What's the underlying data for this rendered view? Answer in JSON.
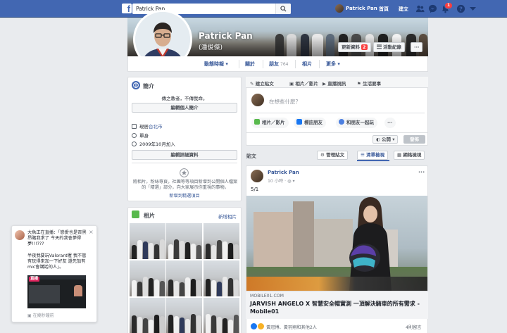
{
  "topbar": {
    "search_value": "Patrick Pan",
    "search_placeholder": "搜尋",
    "user_name": "Patrick Pan",
    "home": "首頁",
    "create": "建立",
    "notif_count": "1"
  },
  "profile": {
    "name": "Patrick Pan",
    "alt_name": "(潘俊傑)",
    "update_info": "更新資料",
    "update_count": "2",
    "activity_log": "活動紀錄",
    "more": "···"
  },
  "tabs": [
    {
      "label": "動態時報 ▾"
    },
    {
      "label": "關於"
    },
    {
      "label": "朋友",
      "count": "764"
    },
    {
      "label": "相片"
    },
    {
      "label": "更多 ▾"
    }
  ],
  "intro": {
    "title": "簡介",
    "bio": "傳之教者，不傳我命。",
    "edit_bio": "編輯個人簡介",
    "location_prefix": "現居",
    "location_city": "台北市",
    "relationship": "單身",
    "joined": "2009年10月加入",
    "edit_details": "編輯詳細資料",
    "featured_text": "將相片，粉絲專頁，社團等等項目新增到公開個人檔案的「精選」部分，向大家展示你重視的事物。",
    "featured_link": "新增到精選項目"
  },
  "photos": {
    "title": "相片",
    "add_link": "新增相片"
  },
  "composer": {
    "tab_post": "建立貼文",
    "tab_photo": "相片／影片",
    "tab_live": "直播視訊",
    "tab_event": "生活要事",
    "placeholder": "在想些什麼？",
    "btn_photo": "相片／影片",
    "btn_tag": "標註朋友",
    "btn_feeling": "和朋友一起玩",
    "btn_more": "···",
    "privacy": "公開 ▾",
    "post": "發佈"
  },
  "feed": {
    "label": "貼文",
    "manage": "管理貼文",
    "list_view": "清單檢視",
    "grid_view": "網格檢視"
  },
  "post": {
    "author": "Patrick Pan",
    "time": "10 小時 · ",
    "body": "5/1",
    "link_domain": "MOBILE01.COM",
    "link_title": "JARVISH ANGELO X 智慧安全帽實測 一頂解決騎車的所有需求 - Mobile01",
    "reactions": "黃冠博、黃羽翔和其他2人",
    "comments": "4則留言",
    "options": "···"
  },
  "live_popup": {
    "text1": "大魚正在直播：「戀愛也是否黑昂賭我求了 今天的我會夢得夢!!!???",
    "text2": "半夜我要玩Valorant喔 我不管 有玩得來加一下好友 還先加有mic會講話的人」。",
    "badge": "直播",
    "footer": "在幾秒鐘前",
    "close": "×"
  },
  "colors": {
    "fb_blue": "#4267b2",
    "link_blue": "#385898",
    "notif_red": "#fa3e3e",
    "page_bg": "#e9ebee"
  }
}
